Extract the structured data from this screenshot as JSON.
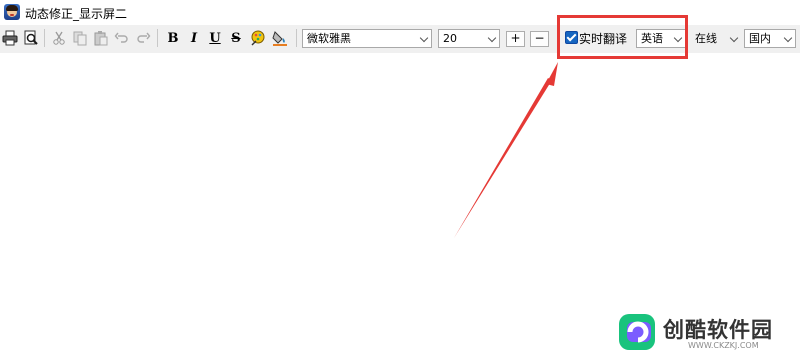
{
  "window": {
    "title": "动态修正_显示屏二"
  },
  "toolbar": {
    "icons": [
      "print-icon",
      "print-preview-icon",
      "cut-icon",
      "copy-icon",
      "paste-icon",
      "undo-icon",
      "redo-icon",
      "bold-icon",
      "italic-icon",
      "underline-icon",
      "strikethrough-icon",
      "text-color-icon",
      "background-color-icon"
    ],
    "bold_label": "B",
    "italic_label": "I",
    "underline_label": "U",
    "strike_label": "S",
    "font_family": "微软雅黑",
    "font_size": "20",
    "increase_label": "+",
    "decrease_label": "−",
    "realtime_translate": {
      "label": "实时翻译",
      "checked": true
    },
    "language": "英语",
    "mode": "在线",
    "region": "国内"
  },
  "annotation": {
    "color": "#e53935"
  },
  "watermark": {
    "name": "创酷软件园",
    "url": "WWW.CKZKJ.COM"
  }
}
